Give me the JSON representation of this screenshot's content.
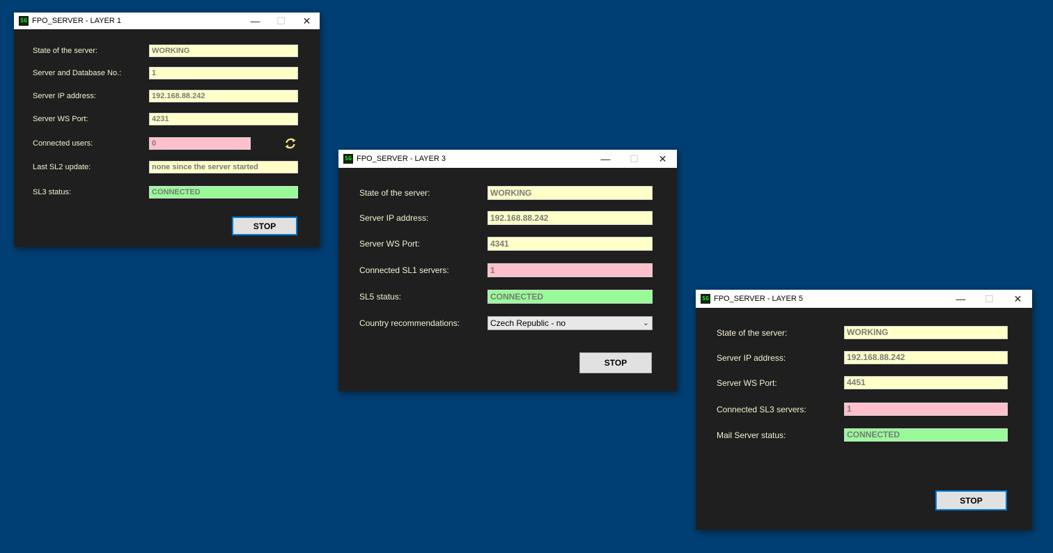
{
  "windows": [
    {
      "title": "FPO_SERVER - LAYER 1",
      "rows": [
        {
          "label": "State of the server:",
          "value": "WORKING"
        },
        {
          "label": "Server and Database No.:",
          "value": "1"
        },
        {
          "label": "Server IP address:",
          "value": "192.168.88.242"
        },
        {
          "label": "Server WS Port:",
          "value": "4231"
        },
        {
          "label": "Connected users:",
          "value": "0"
        },
        {
          "label": "Last SL2 update:",
          "value": "none since the server started"
        },
        {
          "label": "SL3 status:",
          "value": "CONNECTED"
        }
      ],
      "stop_label": "STOP"
    },
    {
      "title": "FPO_SERVER - LAYER 3",
      "rows": [
        {
          "label": "State of the server:",
          "value": "WORKING"
        },
        {
          "label": "Server IP address:",
          "value": "192.168.88.242"
        },
        {
          "label": "Server WS Port:",
          "value": "4341"
        },
        {
          "label": "Connected SL1 servers:",
          "value": "1"
        },
        {
          "label": "SL5 status:",
          "value": "CONNECTED"
        },
        {
          "label": "Country recommendations:",
          "value": "Czech Republic - no"
        }
      ],
      "stop_label": "STOP"
    },
    {
      "title": "FPO_SERVER - LAYER 5",
      "rows": [
        {
          "label": "State of the server:",
          "value": "WORKING"
        },
        {
          "label": "Server IP address:",
          "value": "192.168.88.242"
        },
        {
          "label": "Server WS Port:",
          "value": "4451"
        },
        {
          "label": "Connected SL3 servers:",
          "value": "1"
        },
        {
          "label": "Mail Server status:",
          "value": "CONNECTED"
        }
      ],
      "stop_label": "STOP"
    }
  ],
  "colors": {
    "desktop": "#003f74",
    "window_bg": "#1f1f1f",
    "field_yellow": "#ffffc8",
    "field_pink": "#ffc0cb",
    "field_green": "#98fb98",
    "label_text": "#f3f0d0",
    "focus_border": "#0078d7"
  },
  "icons": {
    "app": "sg-app-icon",
    "minimize": "minimize-icon",
    "maximize": "maximize-icon",
    "close": "close-icon",
    "refresh": "refresh-icon",
    "dropdown": "chevron-down-icon"
  }
}
